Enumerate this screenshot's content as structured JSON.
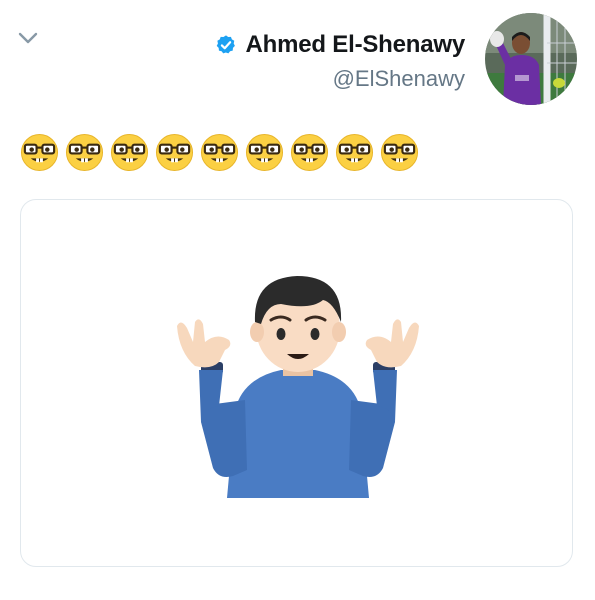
{
  "tweet": {
    "author": {
      "display_name": "Ahmed El-Shenawy",
      "handle": "@ElShenawy",
      "verified": true
    },
    "emojis": [
      "nerd-face",
      "nerd-face",
      "nerd-face",
      "nerd-face",
      "nerd-face",
      "nerd-face",
      "nerd-face",
      "nerd-face",
      "nerd-face"
    ],
    "media": {
      "icon": "person-shrugging"
    }
  },
  "colors": {
    "verified_blue": "#1da1f2",
    "text_primary": "#14171a",
    "text_secondary": "#657786",
    "border": "#e1e8ed"
  }
}
